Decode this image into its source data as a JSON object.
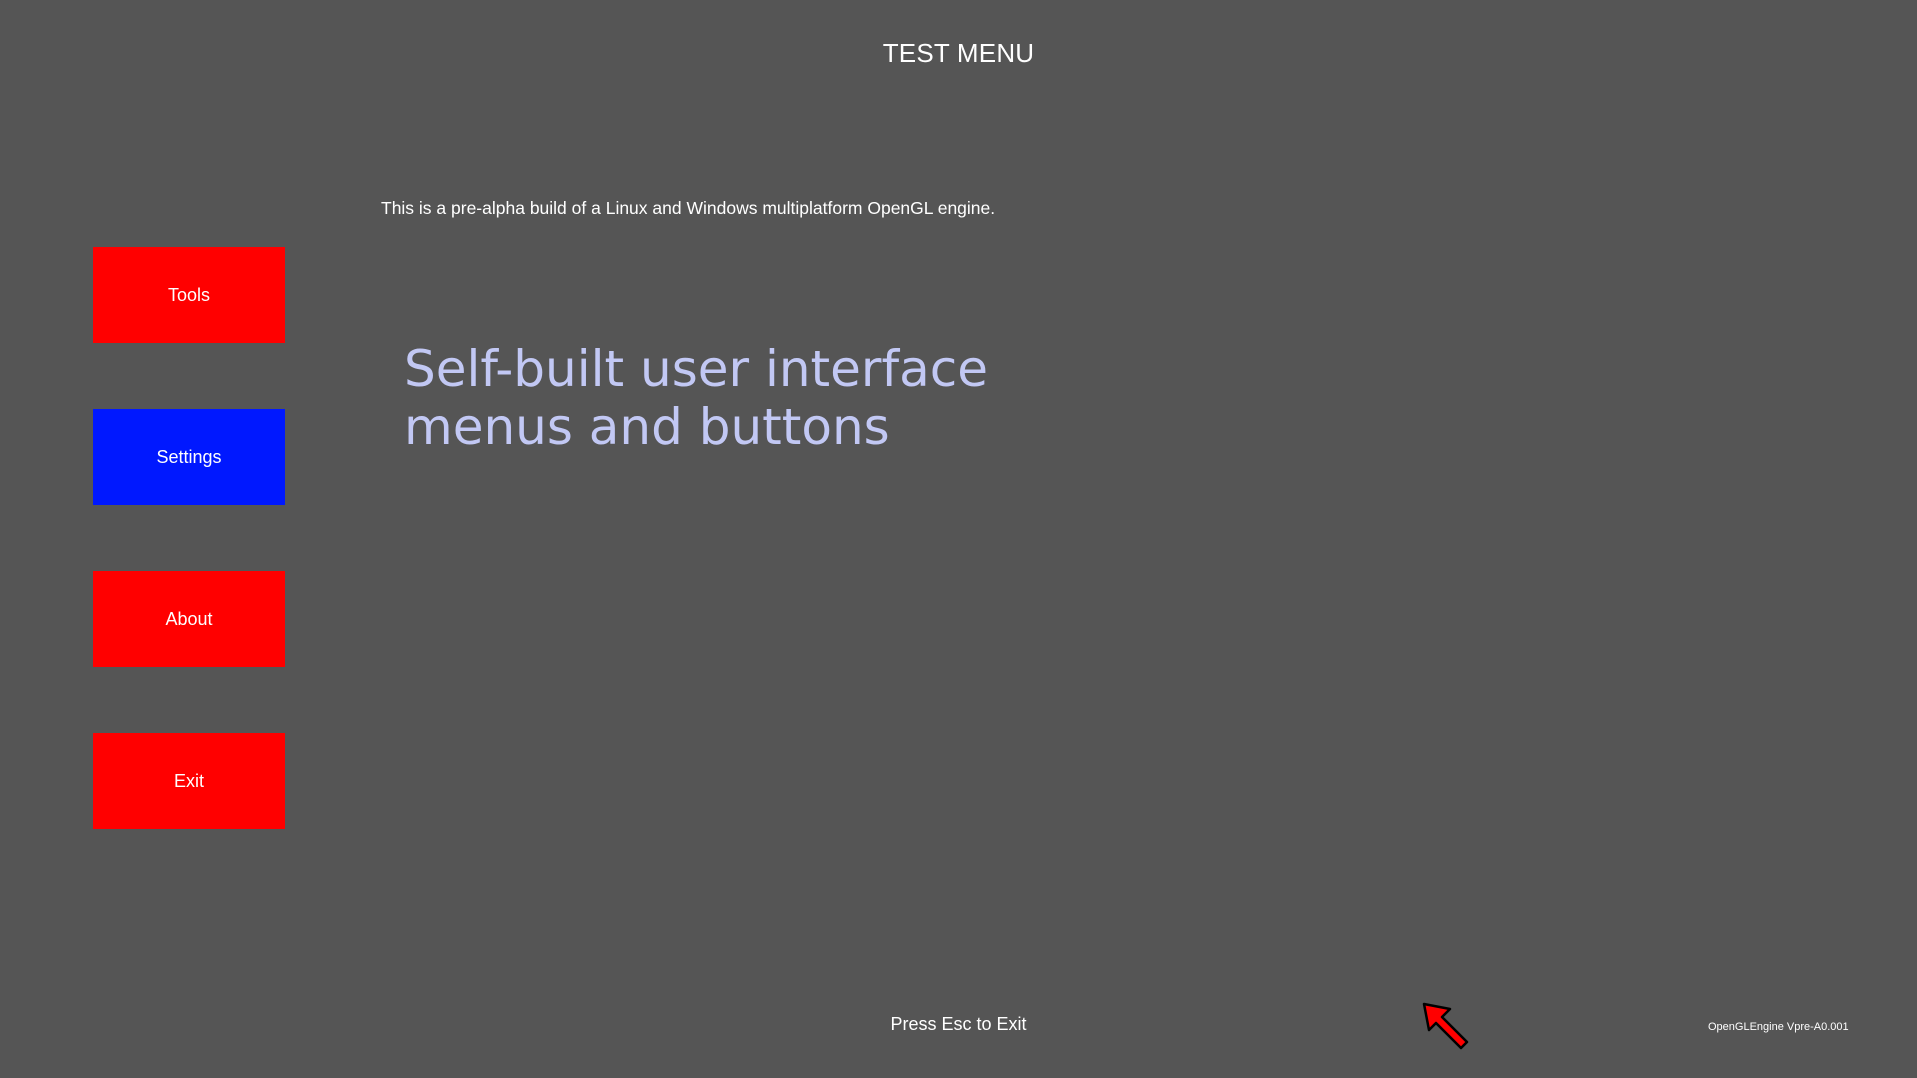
{
  "header": {
    "title": "TEST MENU"
  },
  "intro": {
    "description": "This is a pre-alpha build of a Linux and Windows multiplatform OpenGL engine.",
    "headline": "Self-built user interface\nmenus and buttons"
  },
  "menu": {
    "items": [
      {
        "label": "Tools",
        "color": "#ff0000"
      },
      {
        "label": "Settings",
        "color": "#0018ff"
      },
      {
        "label": "About",
        "color": "#ff0000"
      },
      {
        "label": "Exit",
        "color": "#ff0000"
      }
    ]
  },
  "footer": {
    "hint": "Press Esc to Exit",
    "version": "OpenGLEngine Vpre-A0.001"
  },
  "colors": {
    "background": "#555555",
    "headline": "#c2c8f4",
    "button_default": "#ff0000",
    "button_selected": "#0018ff",
    "cursor_fill": "#ff0000"
  },
  "cursor": {
    "icon": "red-arrow-cursor-icon"
  }
}
